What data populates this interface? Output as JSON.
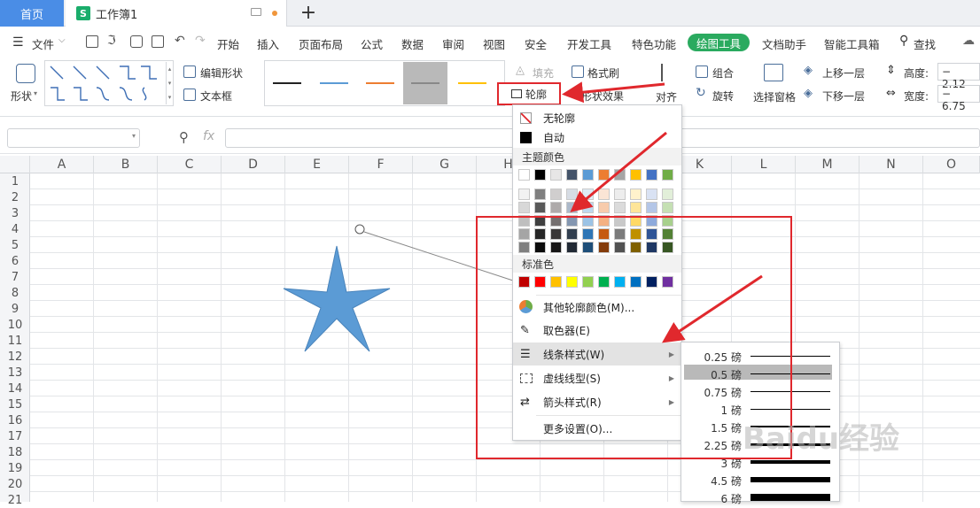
{
  "tabs": {
    "home": "首页",
    "workbook": "工作簿1",
    "new_tab": "+"
  },
  "menu": {
    "file": "文件",
    "items": [
      "开始",
      "插入",
      "页面布局",
      "公式",
      "数据",
      "审阅",
      "视图",
      "安全",
      "开发工具",
      "特色功能"
    ],
    "active": "绘图工具",
    "after": [
      "文档助手",
      "智能工具箱"
    ],
    "search": "查找"
  },
  "ribbon": {
    "shape": "形状",
    "edit_shape": "编辑形状",
    "text_box": "文本框",
    "fill": "填充",
    "outline": "轮廓",
    "shape_effect": "形状效果",
    "format_painter": "格式刷",
    "align": "对齐",
    "group": "组合",
    "rotate": "旋转",
    "select_pane": "选择窗格",
    "bring_forward": "上移一层",
    "send_backward": "下移一层",
    "height_label": "高度:",
    "width_label": "宽度:",
    "height_value": "2.12",
    "width_value": "6.75"
  },
  "formula": {
    "fx": "fx"
  },
  "columns": [
    "A",
    "B",
    "C",
    "D",
    "E",
    "F",
    "G",
    "H",
    "I",
    "J",
    "K",
    "L",
    "M",
    "N",
    "O"
  ],
  "rows": [
    "1",
    "2",
    "3",
    "4",
    "5",
    "6",
    "7",
    "8",
    "9",
    "10",
    "11",
    "12",
    "13",
    "14",
    "15",
    "16",
    "17",
    "18",
    "19",
    "20",
    "21"
  ],
  "dropdown": {
    "no_outline": "无轮廓",
    "auto": "自动",
    "theme_colors": "主题颜色",
    "standard_colors": "标准色",
    "more_colors": "其他轮廓颜色(M)...",
    "eyedropper": "取色器(E)",
    "line_style": "线条样式(W)",
    "dash_type": "虚线线型(S)",
    "arrow_style": "箭头样式(R)",
    "more_settings": "更多设置(O)...",
    "theme_top_row": [
      "#ffffff",
      "#000000",
      "#e7e6e6",
      "#44546a",
      "#5b9bd5",
      "#ed7d31",
      "#a5a5a5",
      "#ffc000",
      "#4472c4",
      "#70ad47"
    ],
    "theme_shades": [
      [
        "#f2f2f2",
        "#7f7f7f",
        "#d0cece",
        "#d6dce4",
        "#deebf6",
        "#fbe5d5",
        "#ededed",
        "#fff2cc",
        "#d9e2f3",
        "#e2efd9"
      ],
      [
        "#d8d8d8",
        "#595959",
        "#aeaaaa",
        "#acb9ca",
        "#bdd7ee",
        "#f7cbac",
        "#dbdbdb",
        "#fee599",
        "#b4c6e7",
        "#c5e0b3"
      ],
      [
        "#bfbfbf",
        "#3f3f3f",
        "#757070",
        "#8496b0",
        "#9cc3e5",
        "#f4b183",
        "#c9c9c9",
        "#ffd965",
        "#8eaadb",
        "#a8d08d"
      ],
      [
        "#a5a5a5",
        "#262626",
        "#3a3838",
        "#323f4f",
        "#2e75b5",
        "#c55a11",
        "#7b7b7b",
        "#bf9000",
        "#2f5496",
        "#538135"
      ],
      [
        "#7f7f7f",
        "#0c0c0c",
        "#171616",
        "#222a35",
        "#1e4e79",
        "#843c0b",
        "#525252",
        "#7f6000",
        "#1f3864",
        "#375623"
      ]
    ],
    "standard": [
      "#c00000",
      "#ff0000",
      "#ffc000",
      "#ffff00",
      "#92d050",
      "#00b050",
      "#00b0f0",
      "#0070c0",
      "#002060",
      "#7030a0"
    ]
  },
  "line_widths": [
    {
      "label": "0.25 磅",
      "thickness": 0.25
    },
    {
      "label": "0.5 磅",
      "thickness": 0.5
    },
    {
      "label": "0.75 磅",
      "thickness": 0.75
    },
    {
      "label": "1 磅",
      "thickness": 1
    },
    {
      "label": "1.5 磅",
      "thickness": 1.5
    },
    {
      "label": "2.25 磅",
      "thickness": 2.25
    },
    {
      "label": "3 磅",
      "thickness": 3
    },
    {
      "label": "4.5 磅",
      "thickness": 4.5
    },
    {
      "label": "6 磅",
      "thickness": 6
    }
  ],
  "selected_line_width": "0.5 磅",
  "colors": {
    "accent_green": "#2aaa5f",
    "home_tab_blue": "#4a8de6",
    "annotation_red": "#e0282d",
    "star_blue": "#5b9bd5"
  },
  "watermark": "Baidu经验"
}
